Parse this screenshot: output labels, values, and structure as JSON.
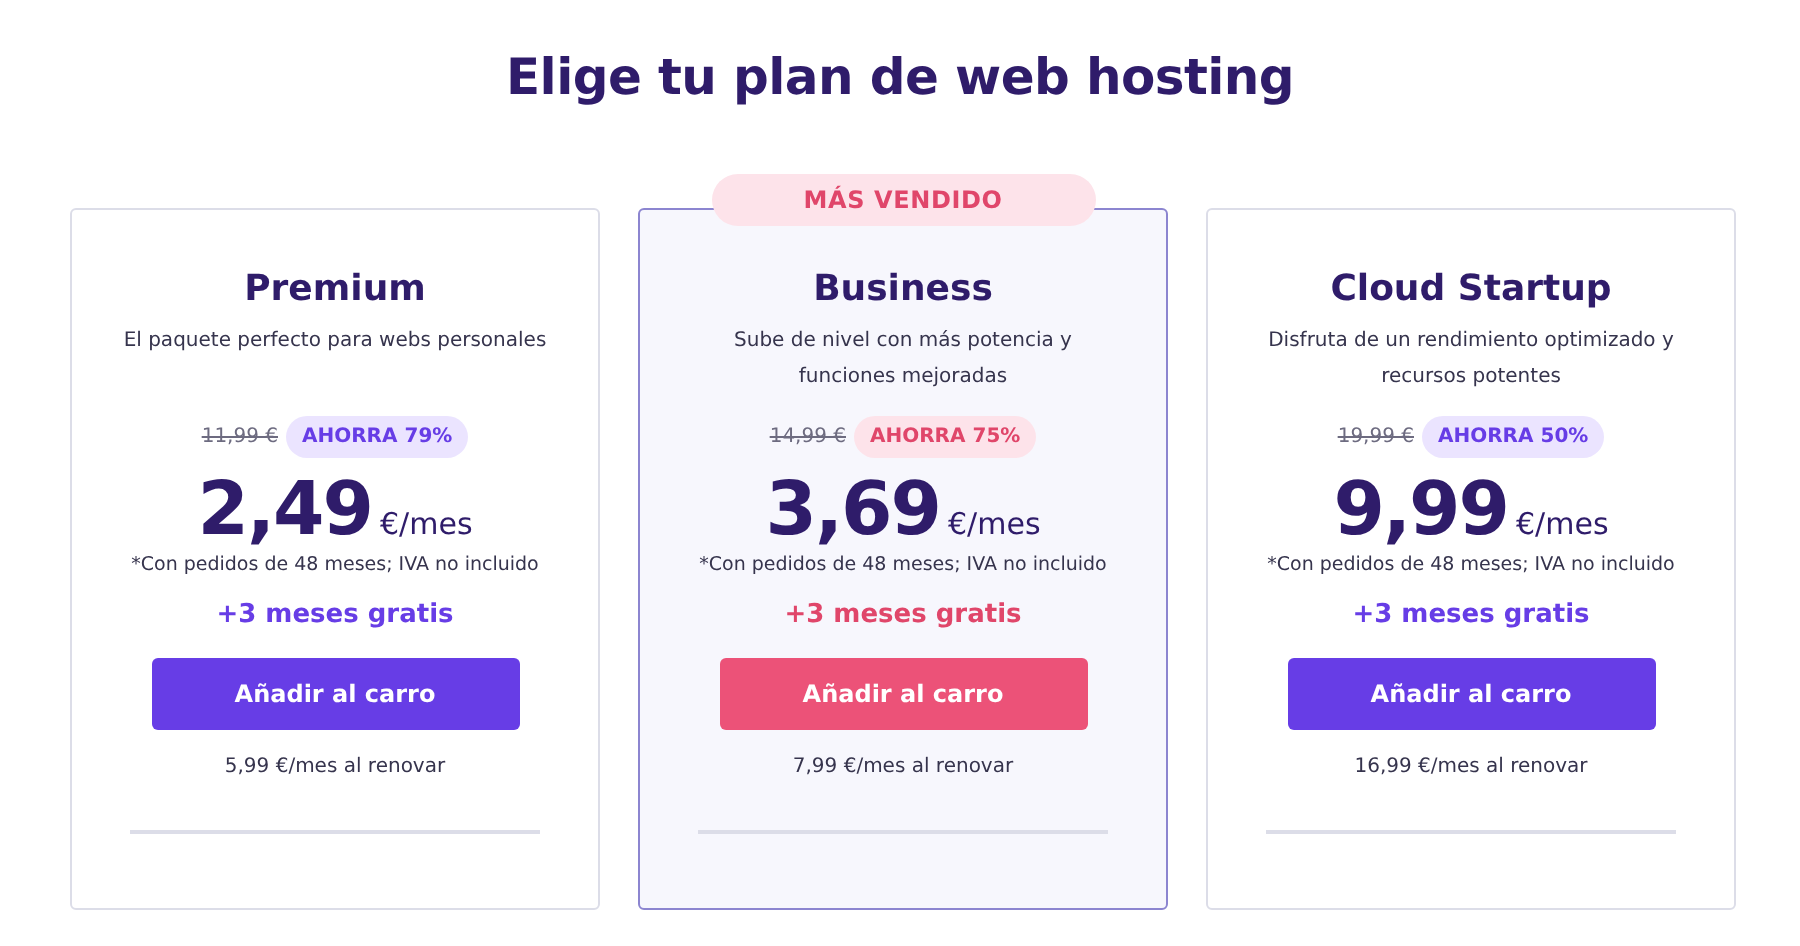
{
  "heading": "Elige tu plan de web hosting",
  "plans": [
    {
      "name": "Premium",
      "description": "El paquete perfecto para webs personales",
      "old_price": "11,99 €",
      "discount": "AHORRA 79%",
      "price": "2,49",
      "unit": "€/mes",
      "note": "*Con pedidos de 48 meses; IVA no incluido",
      "bonus": "+3 meses gratis",
      "button": "Añadir al carro",
      "renewal": "5,99 €/mes al renovar",
      "featured": false
    },
    {
      "name": "Business",
      "badge": "MÁS VENDIDO",
      "description": "Sube de nivel con más potencia y funciones mejoradas",
      "old_price": "14,99 €",
      "discount": "AHORRA 75%",
      "price": "3,69",
      "unit": "€/mes",
      "note": "*Con pedidos de 48 meses; IVA no incluido",
      "bonus": "+3 meses gratis",
      "button": "Añadir al carro",
      "renewal": "7,99 €/mes al renovar",
      "featured": true
    },
    {
      "name": "Cloud Startup",
      "description": "Disfruta de un rendimiento optimizado y recursos potentes",
      "old_price": "19,99 €",
      "discount": "AHORRA 50%",
      "price": "9,99",
      "unit": "€/mes",
      "note": "*Con pedidos de 48 meses; IVA no incluido",
      "bonus": "+3 meses gratis",
      "button": "Añadir al carro",
      "renewal": "16,99 €/mes al renovar",
      "featured": false
    }
  ]
}
